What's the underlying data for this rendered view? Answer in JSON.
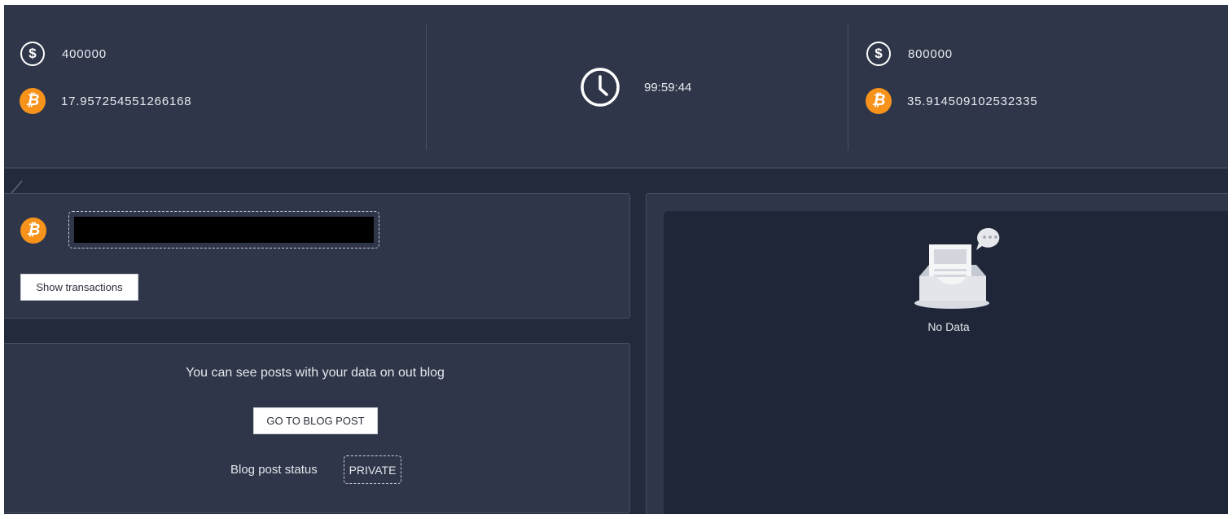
{
  "stats": {
    "left": {
      "usd": "400000",
      "btc": "17.957254551266168"
    },
    "timer": "99:59:44",
    "right": {
      "usd": "800000",
      "btc": "35.914509102532335"
    }
  },
  "icons": {
    "dollar_symbol": "$",
    "btc_symbol": "₿"
  },
  "wallet_panel": {
    "show_transactions_label": "Show transactions"
  },
  "blog_panel": {
    "message": "You can see posts with your data on out blog",
    "go_button_label": "GO TO BLOG POST",
    "status_label": "Blog post status",
    "status_value": "PRIVATE"
  },
  "data_panel": {
    "empty_text": "No Data"
  },
  "colors": {
    "bitcoin": "#f7931a",
    "background": "#232a3b",
    "panel": "#2f3649"
  }
}
